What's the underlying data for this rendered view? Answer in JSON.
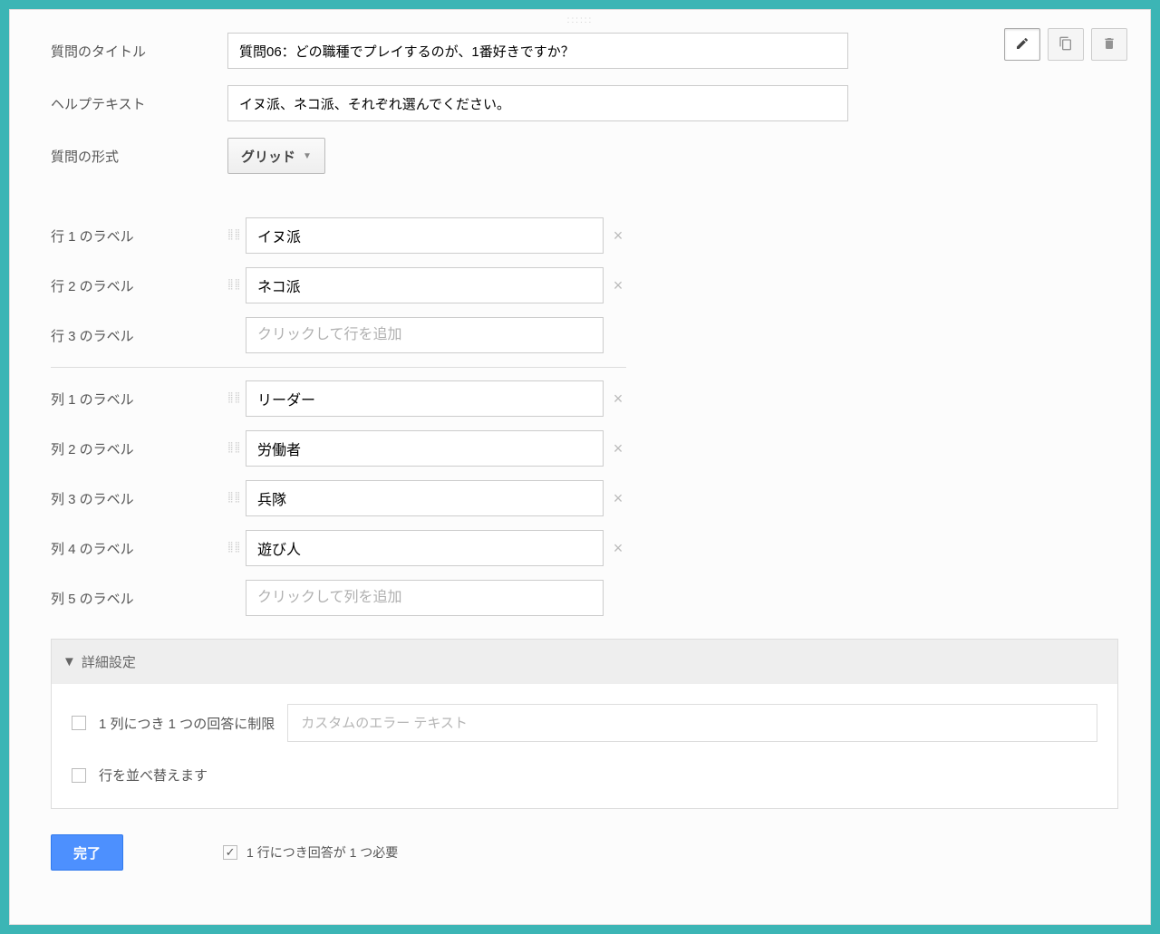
{
  "labels": {
    "title": "質問のタイトル",
    "help": "ヘルプテキスト",
    "type": "質問の形式",
    "row1": "行 1 のラベル",
    "row2": "行 2 のラベル",
    "row3": "行 3 のラベル",
    "col1": "列 1 のラベル",
    "col2": "列 2 のラベル",
    "col3": "列 3 のラベル",
    "col4": "列 4 のラベル",
    "col5": "列 5 のラベル"
  },
  "values": {
    "title": "質問06：どの職種でプレイするのが、1番好きですか？",
    "help": "イヌ派、ネコ派、それぞれ選んでください。",
    "type": "グリッド"
  },
  "rows": {
    "r1": "イヌ派",
    "r2": "ネコ派"
  },
  "cols": {
    "c1": "リーダー",
    "c2": "労働者",
    "c3": "兵隊",
    "c4": "遊び人"
  },
  "placeholders": {
    "addRow": "クリックして行を追加",
    "addCol": "クリックして列を追加",
    "errorText": "カスタムのエラー テキスト"
  },
  "advanced": {
    "header": "詳細設定",
    "limitOne": "1 列につき 1 つの回答に制限",
    "shuffle": "行を並べ替えます"
  },
  "footer": {
    "done": "完了",
    "require": "1 行につき回答が 1 つ必要"
  }
}
